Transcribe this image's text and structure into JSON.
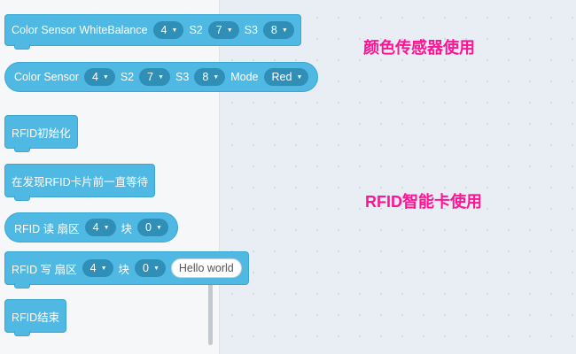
{
  "annotations": {
    "color_sensor_usage": "颜色传感器使用",
    "rfid_usage": "RFID智能卡使用",
    "color": "#ff1493"
  },
  "blocks": {
    "color_wb": {
      "label": "Color Sensor WhiteBalance",
      "dd1": "4",
      "s2_label": "S2",
      "dd2": "7",
      "s3_label": "S3",
      "dd3": "8"
    },
    "color_sensor": {
      "label": "Color Sensor",
      "dd1": "4",
      "s2_label": "S2",
      "dd2": "7",
      "s3_label": "S3",
      "dd3": "8",
      "mode_label": "Mode",
      "mode_value": "Red"
    },
    "rfid_init": {
      "label": "RFID初始化"
    },
    "rfid_wait": {
      "label": "在发现RFID卡片前一直等待"
    },
    "rfid_read": {
      "label": "RFID 读 扇区",
      "sector": "4",
      "block_label": "块",
      "block": "0"
    },
    "rfid_write": {
      "label": "RFID 写 扇区",
      "sector": "4",
      "block_label": "块",
      "block": "0",
      "text": "Hello world"
    },
    "rfid_end": {
      "label": "RFID结束"
    }
  },
  "colors": {
    "block_fill": "#4fb9e3",
    "block_border": "#3aa6d2",
    "dropdown_fill": "#2f8fb6",
    "workspace_bg": "#e9eef4",
    "palette_bg": "#f5f7f9"
  },
  "icons": {
    "dropdown": "caret-down-icon"
  }
}
